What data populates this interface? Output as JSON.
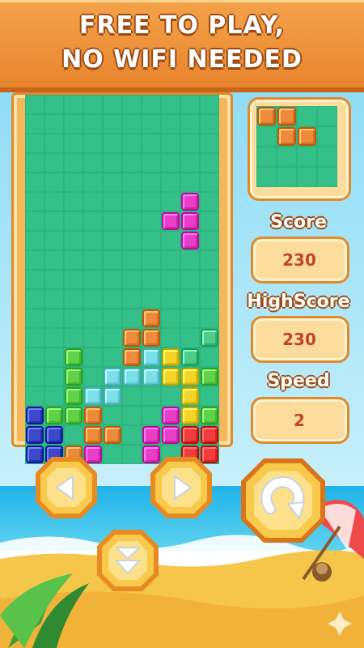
{
  "banner": {
    "line1": "FREE TO PLAY,",
    "line2": "NO WIFI NEEDED"
  },
  "stats": {
    "score_label": "Score",
    "score_value": "230",
    "highscore_label": "HighScore",
    "highscore_value": "230",
    "speed_label": "Speed",
    "speed_value": "2"
  },
  "board": {
    "columns": 10,
    "rows": 17,
    "colors": {
      "O": "#ee8a3c",
      "B": "#7be0ea",
      "Y": "#f4d42a",
      "G": "#5fd24a",
      "P": "#e83fc6",
      "N": "#3c49c9",
      "R": "#ef3d3d",
      "F": "#4fcd8a"
    },
    "grid": [
      "..........",
      "..........",
      "..........",
      "..........",
      "..........",
      "........P.",
      ".......PP.",
      "........P.",
      "..........",
      "..........",
      "..........",
      "......O...",
      ".....OO..F",
      "..G..OBYF.",
      "..G.BBBYYG",
      "..GBB...Y.",
      "NGGO...PYG",
      "NN.OO.PPRR",
      "NNOP..P.RR"
    ]
  },
  "next_piece": {
    "grid": [
      "OO..",
      ".OO.",
      "....",
      "...."
    ]
  },
  "controls": [
    "left",
    "right",
    "rotate",
    "down"
  ]
}
